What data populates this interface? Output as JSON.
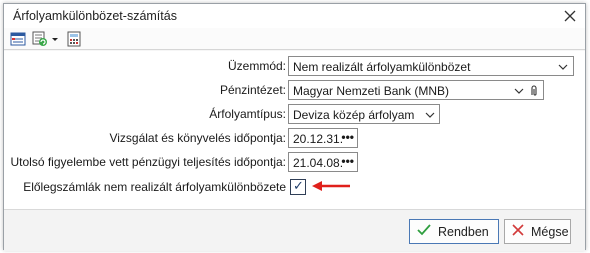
{
  "window": {
    "title": "Árfolyamkülönbözet-számítás"
  },
  "toolbar": {
    "icons": [
      "table-icon",
      "refresh-list-icon",
      "dropdown-arrow-icon",
      "calculator-icon"
    ]
  },
  "form": {
    "uzemmod": {
      "label": "Üzemmód:",
      "value": "Nem realizált árfolyamkülönbözet"
    },
    "penzintezet": {
      "label": "Pénzintézet:",
      "value": "Magyar Nemzeti Bank (MNB)"
    },
    "arfolyamtipus": {
      "label": "Árfolyamtípus:",
      "value": "Deviza közép árfolyam"
    },
    "vizsgalat": {
      "label": "Vizsgálat és könyvelés időpontja:",
      "value": "20.12.31."
    },
    "utolso": {
      "label": "Utolsó figyelembe vett pénzügyi teljesítés időpontja:",
      "value": "21.04.08."
    },
    "eloleg": {
      "label": "Előlegszámlák nem realizált árfolyamkülönbözete",
      "checked": true,
      "check_mark": "✓"
    },
    "picker_dots": "•••"
  },
  "buttons": {
    "ok": "Rendben",
    "cancel": "Mégse"
  },
  "colors": {
    "annotation_arrow": "#e0201b",
    "ok_check": "#2e9e3e",
    "cancel_x": "#d23a3a"
  }
}
